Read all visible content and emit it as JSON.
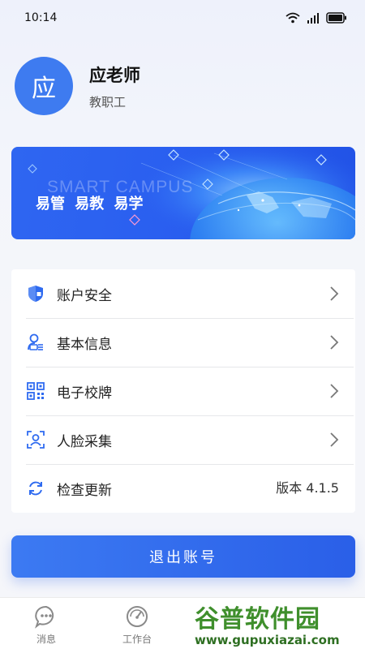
{
  "status_bar": {
    "time": "10:14"
  },
  "profile": {
    "avatar_char": "应",
    "name": "应老师",
    "role": "教职工"
  },
  "banner": {
    "english": "SMART CAMPUS",
    "slogan": "易管  易教  易学"
  },
  "menu": {
    "items": [
      {
        "label": "账户安全",
        "icon": "shield-icon"
      },
      {
        "label": "基本信息",
        "icon": "user-info-icon"
      },
      {
        "label": "电子校牌",
        "icon": "qr-code-icon"
      },
      {
        "label": "人脸采集",
        "icon": "face-scan-icon"
      },
      {
        "label": "检查更新",
        "icon": "refresh-icon",
        "value": "版本 4.1.5"
      }
    ]
  },
  "logout": {
    "label": "退出账号"
  },
  "tabbar": {
    "tabs": [
      {
        "label": "消息",
        "icon": "message-icon"
      },
      {
        "label": "工作台",
        "icon": "dashboard-icon"
      }
    ]
  },
  "watermark": {
    "text": "谷普软件园",
    "url": "www.gupuxiazai.com"
  },
  "colors": {
    "accent": "#3e7bf0",
    "icon_blue": "#2f6bf0"
  }
}
